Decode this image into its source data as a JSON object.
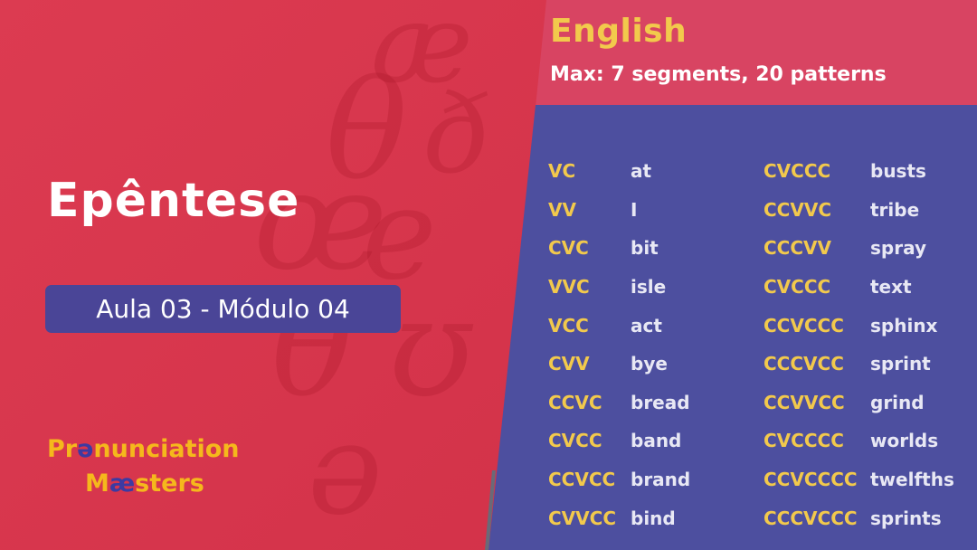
{
  "slide": {
    "title": "Epêntese",
    "lesson_badge": "Aula 03 - Módulo 04"
  },
  "logo": {
    "line1_a": "Pr",
    "line1_accent": "ə",
    "line1_b": "nunciation",
    "line2_a": "M",
    "line2_accent": "æ",
    "line2_b": "sters"
  },
  "panel": {
    "language": "English",
    "subtitle": "Max: 7 segments, 20 patterns",
    "left_column": [
      {
        "pattern": "VC",
        "word": "at"
      },
      {
        "pattern": "VV",
        "word": "I"
      },
      {
        "pattern": "CVC",
        "word": "bit"
      },
      {
        "pattern": "VVC",
        "word": "isle"
      },
      {
        "pattern": "VCC",
        "word": "act"
      },
      {
        "pattern": "CVV",
        "word": "bye"
      },
      {
        "pattern": "CCVC",
        "word": "bread"
      },
      {
        "pattern": "CVCC",
        "word": "band"
      },
      {
        "pattern": "CCVCC",
        "word": "brand"
      },
      {
        "pattern": "CVVCC",
        "word": "bind"
      }
    ],
    "right_column": [
      {
        "pattern": "CVCCC",
        "word": "busts"
      },
      {
        "pattern": "CCVVC",
        "word": "tribe"
      },
      {
        "pattern": "CCCVV",
        "word": "spray"
      },
      {
        "pattern": "CVCCC",
        "word": "text"
      },
      {
        "pattern": "CCVCCC",
        "word": "sphinx"
      },
      {
        "pattern": "CCCVCC",
        "word": "sprint"
      },
      {
        "pattern": "CCVVCC",
        "word": "grind"
      },
      {
        "pattern": "CVCCCC",
        "word": "worlds"
      },
      {
        "pattern": "CCVCCCC",
        "word": "twelfths"
      },
      {
        "pattern": "CCCVCCC",
        "word": "sprints"
      }
    ]
  },
  "colors": {
    "background_red": "#d9384f",
    "panel_header": "#d84462",
    "panel_body": "#4d4f9f",
    "accent_yellow": "#f2c94c",
    "badge_purple": "#4a4597"
  }
}
